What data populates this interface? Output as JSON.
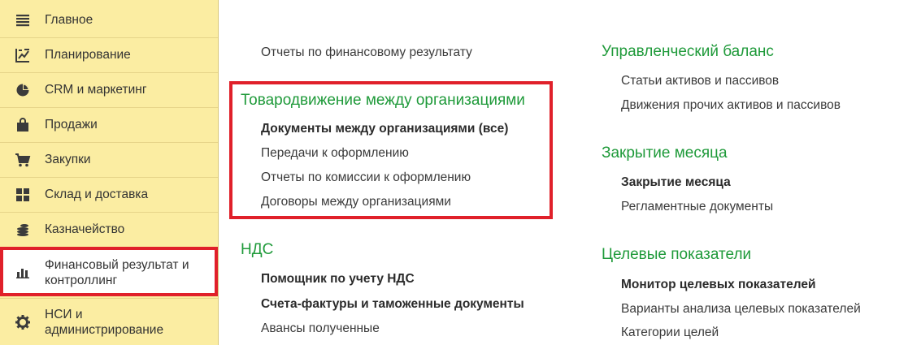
{
  "sidebar": {
    "items": [
      {
        "label": "Главное",
        "icon": "menu-lines-icon"
      },
      {
        "label": "Планирование",
        "icon": "planning-icon"
      },
      {
        "label": "CRM и маркетинг",
        "icon": "pie-chart-icon"
      },
      {
        "label": "Продажи",
        "icon": "shopping-bag-icon"
      },
      {
        "label": "Закупки",
        "icon": "cart-icon"
      },
      {
        "label": "Склад и доставка",
        "icon": "warehouse-icon"
      },
      {
        "label": "Казначейство",
        "icon": "coins-icon"
      },
      {
        "label_line1": "Финансовый результат и",
        "label_line2": "контроллинг",
        "icon": "bar-chart-icon",
        "active": true
      },
      {
        "label_line1": "НСИ и",
        "label_line2": "администрирование",
        "icon": "gear-icon"
      }
    ]
  },
  "content": {
    "col1": {
      "top_link": "Отчеты по финансовому результату",
      "group_goods": {
        "title": "Товародвижение между организациями",
        "links": [
          {
            "label": "Документы между организациями (все)",
            "bold": true
          },
          {
            "label": "Передачи к оформлению",
            "bold": false
          },
          {
            "label": "Отчеты по комиссии к оформлению",
            "bold": false
          },
          {
            "label": "Договоры между организациями",
            "bold": false
          }
        ]
      },
      "group_vat": {
        "title": "НДС",
        "links": [
          {
            "label": "Помощник по учету НДС",
            "bold": true
          },
          {
            "label": "Счета-фактуры и таможенные документы",
            "bold": true
          },
          {
            "label": "Авансы полученные",
            "bold": false
          }
        ]
      }
    },
    "col2": {
      "group_balance": {
        "title": "Управленческий баланс",
        "links": [
          {
            "label": "Статьи активов и пассивов",
            "bold": false
          },
          {
            "label": "Движения прочих активов и пассивов",
            "bold": false
          }
        ]
      },
      "group_close": {
        "title": "Закрытие месяца",
        "links": [
          {
            "label": "Закрытие месяца",
            "bold": true
          },
          {
            "label": "Регламентные документы",
            "bold": false
          }
        ]
      },
      "group_targets": {
        "title": "Целевые показатели",
        "links": [
          {
            "label": "Монитор целевых показателей",
            "bold": true
          },
          {
            "label": "Варианты анализа целевых показателей",
            "bold": false
          },
          {
            "label": "Категории целей",
            "bold": false
          }
        ]
      }
    }
  },
  "colors": {
    "sidebar_bg": "#fbeda2",
    "group_title": "#1f9a3a",
    "highlight": "#e0202a"
  }
}
